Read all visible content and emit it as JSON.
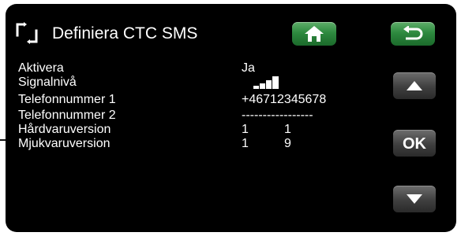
{
  "header": {
    "title": "Definiera CTC SMS",
    "header_icon": "refresh-brackets-icon",
    "home_icon": "home-icon",
    "back_icon": "back-arrow-icon"
  },
  "rows": [
    {
      "label": "Aktivera",
      "value": "Ja"
    },
    {
      "label": "Signalnivå",
      "value_icon": "signal-strength-icon",
      "signal_bars": 4
    },
    {
      "label": "Telefonnummer 1",
      "value": "+46712345678"
    },
    {
      "label": "Telefonnummer 2",
      "value": "-----------------"
    },
    {
      "label": "Hårdvaruversion",
      "value_a": "1",
      "value_b": "1"
    },
    {
      "label": "Mjukvaruversion",
      "value_a": "1",
      "value_b": "9"
    }
  ],
  "side_buttons": {
    "up_icon": "arrow-up-icon",
    "ok_label": "OK",
    "down_icon": "arrow-down-icon"
  },
  "colors": {
    "background": "#000000",
    "green_button": "#2e8a3f",
    "gray_button": "#4a4a4a",
    "text": "#ffffff"
  }
}
